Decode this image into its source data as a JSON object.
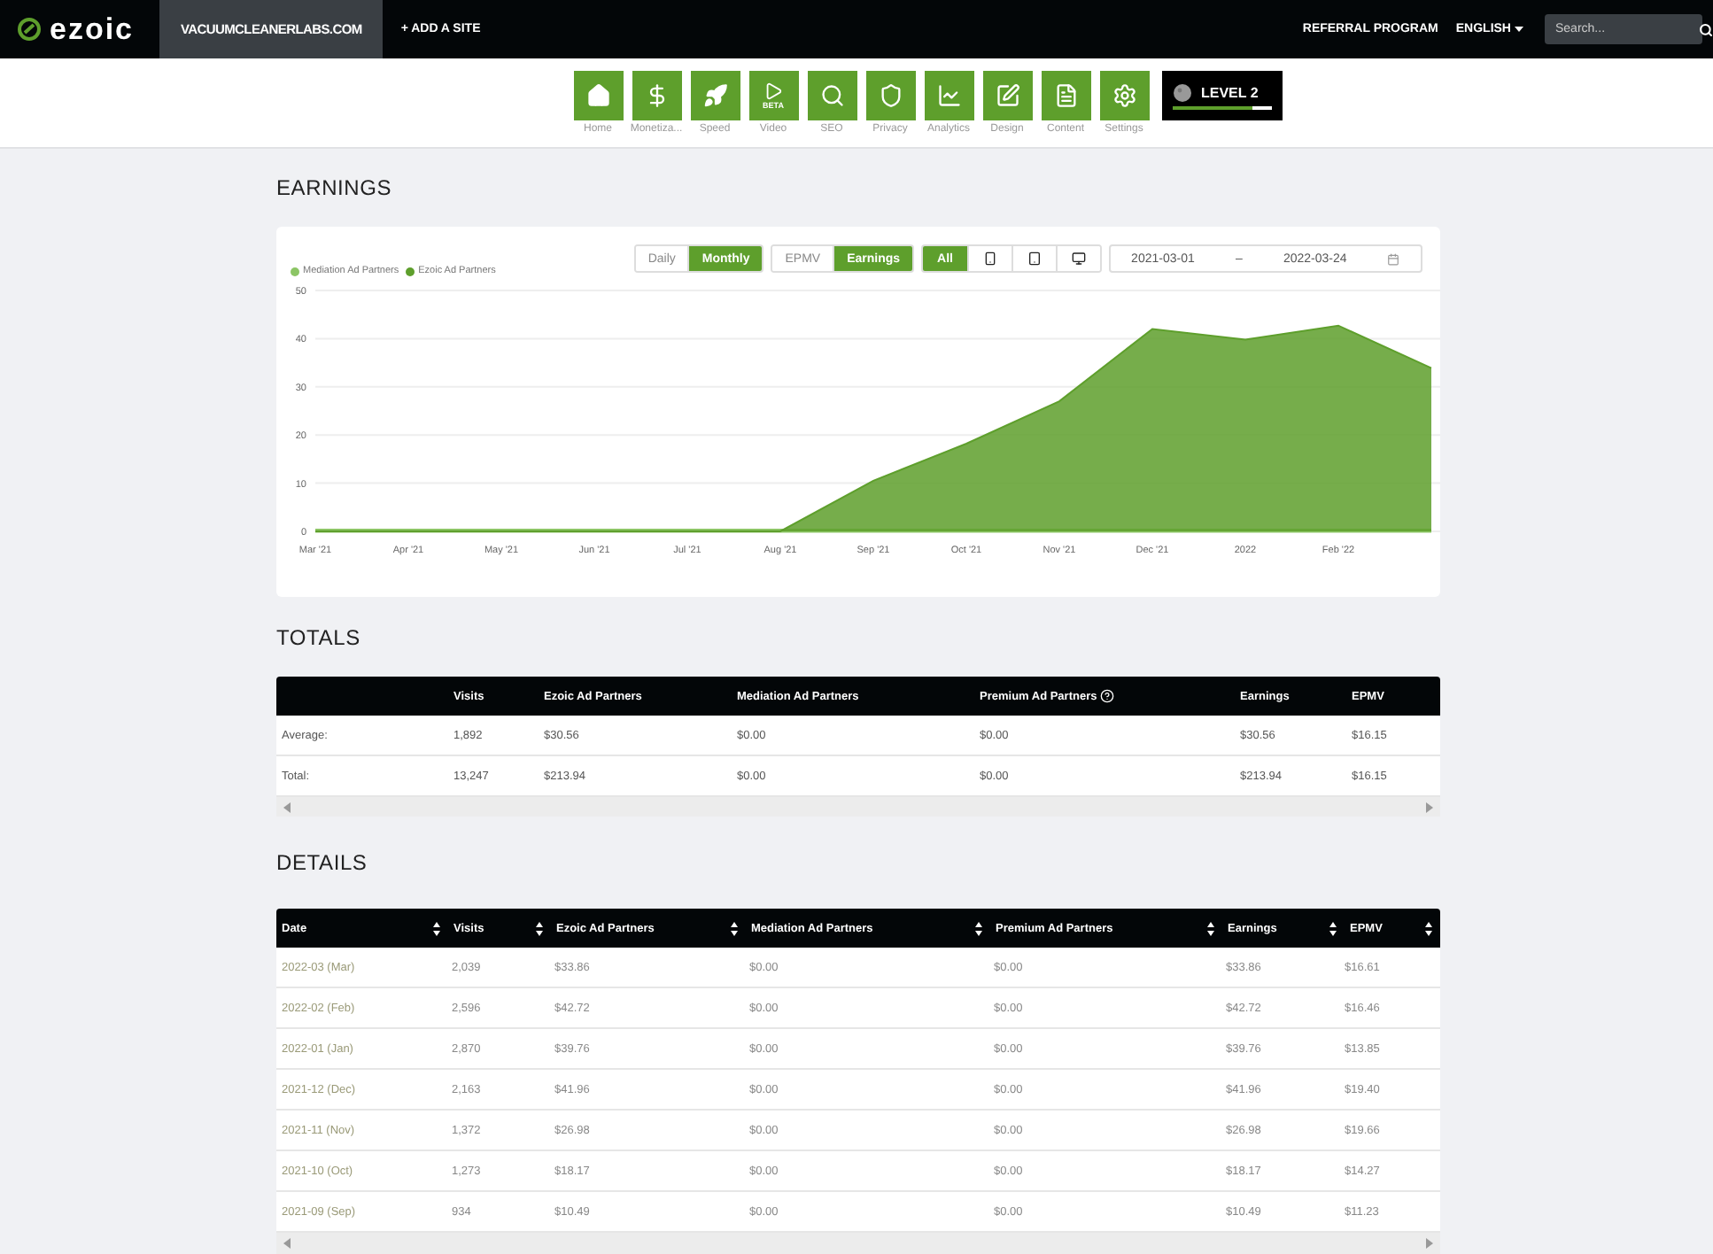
{
  "topbar": {
    "logo": "ezoic",
    "site": "VACUUMCLEANERLABS.COM",
    "add_site": "+ ADD A SITE",
    "referral": "REFERRAL PROGRAM",
    "language": "ENGLISH",
    "search": {
      "placeholder": "Search..."
    }
  },
  "nav": [
    {
      "label": "Home",
      "kind": "home"
    },
    {
      "label": "Monetiza...",
      "kind": "dollar"
    },
    {
      "label": "Speed",
      "kind": "rocket"
    },
    {
      "label": "Video",
      "kind": "video",
      "badge": "BETA"
    },
    {
      "label": "SEO",
      "kind": "search"
    },
    {
      "label": "Privacy",
      "kind": "shield"
    },
    {
      "label": "Analytics",
      "kind": "chart"
    },
    {
      "label": "Design",
      "kind": "design"
    },
    {
      "label": "Content",
      "kind": "content"
    },
    {
      "label": "Settings",
      "kind": "settings"
    }
  ],
  "level": {
    "label": "LEVEL 2",
    "level": 0.8
  },
  "earnings": {
    "title": "EARNINGS",
    "period_toggle": [
      {
        "label": "Daily",
        "selected": false
      },
      {
        "label": "Monthly",
        "selected": true
      }
    ],
    "metric_toggle": [
      {
        "label": "EPMV",
        "selected": false
      },
      {
        "label": "Earnings",
        "selected": true
      }
    ],
    "device_toggle": [
      {
        "kind": "text",
        "label": "All",
        "selected": true
      },
      {
        "kind": "phone",
        "selected": false
      },
      {
        "kind": "tablet",
        "selected": false
      },
      {
        "kind": "desktop",
        "selected": false
      }
    ],
    "date_from": "2021-03-01",
    "date_separator": "–",
    "date_to": "2022-03-24",
    "chart_data": {
      "type": "area",
      "stacked": true,
      "grid": true,
      "categories": [
        "Mar '21",
        "Apr '21",
        "May '21",
        "Jun '21",
        "Jul '21",
        "Aug '21",
        "Sep '21",
        "Oct '21",
        "Nov '21",
        "Dec '21",
        "2022",
        "Feb '22",
        null
      ],
      "ylim": [
        0,
        50
      ],
      "yticks": [
        0,
        10,
        20,
        30,
        40,
        50
      ],
      "series": [
        {
          "name": "Mediation Ad Partners",
          "color": "#8cc565",
          "values": [
            0,
            0,
            0,
            0,
            0,
            0,
            0,
            0,
            0,
            0,
            0,
            0,
            0
          ]
        },
        {
          "name": "Ezoic Ad Partners",
          "color": "#5e9f2c",
          "values": [
            0,
            0,
            0,
            0,
            0,
            0,
            10.5,
            18.2,
            27,
            42,
            39.8,
            42.7,
            33.9
          ]
        }
      ]
    }
  },
  "totals": {
    "title": "TOTALS",
    "columns": [
      {
        "label": "Visits",
        "help": false
      },
      {
        "label": "Ezoic Ad Partners",
        "help": false
      },
      {
        "label": "Mediation Ad Partners",
        "help": false
      },
      {
        "label": "Premium Ad Partners",
        "help": true
      },
      {
        "label": "Earnings",
        "help": false
      },
      {
        "label": "EPMV",
        "help": false
      }
    ],
    "rows": [
      {
        "label": "Average:",
        "cells": [
          "1,892",
          "$30.56",
          "$0.00",
          "$0.00",
          "$30.56",
          "$16.15"
        ]
      },
      {
        "label": "Total:",
        "cells": [
          "13,247",
          "$213.94",
          "$0.00",
          "$0.00",
          "$213.94",
          "$16.15"
        ]
      }
    ]
  },
  "details": {
    "title": "DETAILS",
    "columns": [
      "Date",
      "Visits",
      "Ezoic Ad Partners",
      "Mediation Ad Partners",
      "Premium Ad Partners",
      "Earnings",
      "EPMV"
    ],
    "rows": [
      [
        "2022-03 (Mar)",
        "2,039",
        "$33.86",
        "$0.00",
        "$0.00",
        "$33.86",
        "$16.61"
      ],
      [
        "2022-02 (Feb)",
        "2,596",
        "$42.72",
        "$0.00",
        "$0.00",
        "$42.72",
        "$16.46"
      ],
      [
        "2022-01 (Jan)",
        "2,870",
        "$39.76",
        "$0.00",
        "$0.00",
        "$39.76",
        "$13.85"
      ],
      [
        "2021-12 (Dec)",
        "2,163",
        "$41.96",
        "$0.00",
        "$0.00",
        "$41.96",
        "$19.40"
      ],
      [
        "2021-11 (Nov)",
        "1,372",
        "$26.98",
        "$0.00",
        "$0.00",
        "$26.98",
        "$19.66"
      ],
      [
        "2021-10 (Oct)",
        "1,273",
        "$18.17",
        "$0.00",
        "$0.00",
        "$18.17",
        "$14.27"
      ],
      [
        "2021-09 (Sep)",
        "934",
        "$10.49",
        "$0.00",
        "$0.00",
        "$10.49",
        "$11.23"
      ]
    ]
  }
}
